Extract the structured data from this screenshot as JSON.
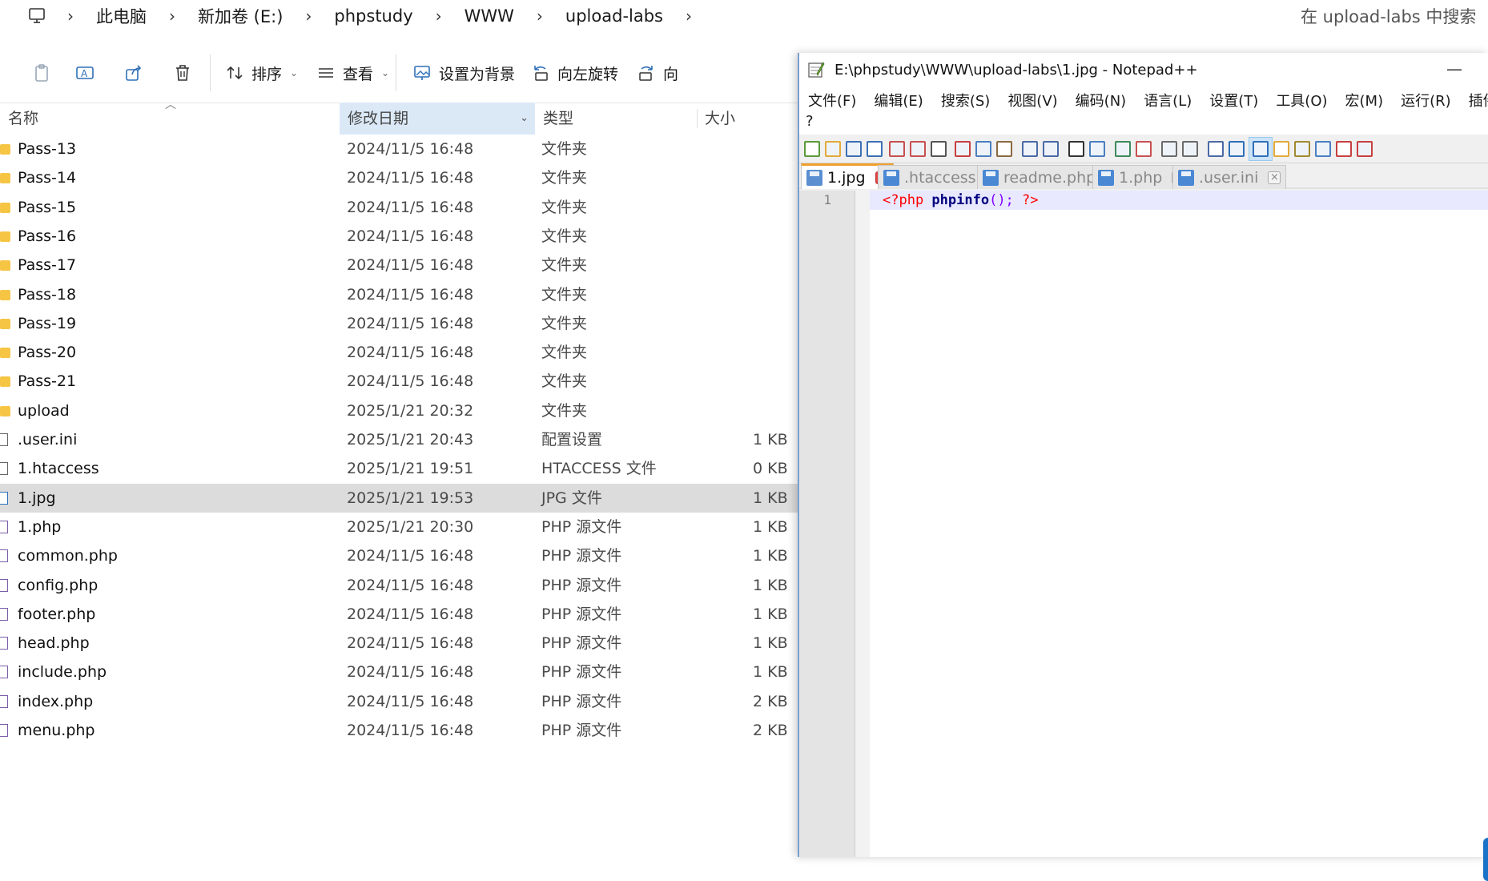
{
  "explorer": {
    "breadcrumb": [
      "此电脑",
      "新加卷 (E:)",
      "phpstudy",
      "WWW",
      "upload-labs"
    ],
    "search_placeholder": "在 upload-labs 中搜索",
    "toolbar": {
      "sort_label": "排序",
      "view_label": "查看",
      "set_bg_label": "设置为背景",
      "rotate_left_label": "向左旋转",
      "rotate_right_label": "向"
    },
    "columns": {
      "name": "名称",
      "date": "修改日期",
      "type": "类型",
      "size": "大小"
    },
    "files": [
      {
        "name": "Pass-13",
        "date": "2024/11/5 16:48",
        "type": "文件夹",
        "size": "",
        "kind": "folder"
      },
      {
        "name": "Pass-14",
        "date": "2024/11/5 16:48",
        "type": "文件夹",
        "size": "",
        "kind": "folder"
      },
      {
        "name": "Pass-15",
        "date": "2024/11/5 16:48",
        "type": "文件夹",
        "size": "",
        "kind": "folder"
      },
      {
        "name": "Pass-16",
        "date": "2024/11/5 16:48",
        "type": "文件夹",
        "size": "",
        "kind": "folder"
      },
      {
        "name": "Pass-17",
        "date": "2024/11/5 16:48",
        "type": "文件夹",
        "size": "",
        "kind": "folder"
      },
      {
        "name": "Pass-18",
        "date": "2024/11/5 16:48",
        "type": "文件夹",
        "size": "",
        "kind": "folder"
      },
      {
        "name": "Pass-19",
        "date": "2024/11/5 16:48",
        "type": "文件夹",
        "size": "",
        "kind": "folder"
      },
      {
        "name": "Pass-20",
        "date": "2024/11/5 16:48",
        "type": "文件夹",
        "size": "",
        "kind": "folder"
      },
      {
        "name": "Pass-21",
        "date": "2024/11/5 16:48",
        "type": "文件夹",
        "size": "",
        "kind": "folder"
      },
      {
        "name": "upload",
        "date": "2025/1/21 20:32",
        "type": "文件夹",
        "size": "",
        "kind": "folder"
      },
      {
        "name": ".user.ini",
        "date": "2025/1/21 20:43",
        "type": "配置设置",
        "size": "1 KB",
        "kind": "file"
      },
      {
        "name": "1.htaccess",
        "date": "2025/1/21 19:51",
        "type": "HTACCESS 文件",
        "size": "0 KB",
        "kind": "file"
      },
      {
        "name": "1.jpg",
        "date": "2025/1/21 19:53",
        "type": "JPG 文件",
        "size": "1 KB",
        "kind": "image",
        "selected": true
      },
      {
        "name": "1.php",
        "date": "2025/1/21 20:30",
        "type": "PHP 源文件",
        "size": "1 KB",
        "kind": "php"
      },
      {
        "name": "common.php",
        "date": "2024/11/5 16:48",
        "type": "PHP 源文件",
        "size": "1 KB",
        "kind": "php"
      },
      {
        "name": "config.php",
        "date": "2024/11/5 16:48",
        "type": "PHP 源文件",
        "size": "1 KB",
        "kind": "php"
      },
      {
        "name": "footer.php",
        "date": "2024/11/5 16:48",
        "type": "PHP 源文件",
        "size": "1 KB",
        "kind": "php"
      },
      {
        "name": "head.php",
        "date": "2024/11/5 16:48",
        "type": "PHP 源文件",
        "size": "1 KB",
        "kind": "php"
      },
      {
        "name": "include.php",
        "date": "2024/11/5 16:48",
        "type": "PHP 源文件",
        "size": "1 KB",
        "kind": "php"
      },
      {
        "name": "index.php",
        "date": "2024/11/5 16:48",
        "type": "PHP 源文件",
        "size": "2 KB",
        "kind": "php"
      },
      {
        "name": "menu.php",
        "date": "2024/11/5 16:48",
        "type": "PHP 源文件",
        "size": "2 KB",
        "kind": "php"
      }
    ]
  },
  "notepad": {
    "title": "E:\\phpstudy\\WWW\\upload-labs\\1.jpg - Notepad++",
    "minimize_glyph": "—",
    "menu": [
      "文件(F)",
      "编辑(E)",
      "搜索(S)",
      "视图(V)",
      "编码(N)",
      "语言(L)",
      "设置(T)",
      "工具(O)",
      "宏(M)",
      "运行(R)",
      "插件(P"
    ],
    "menu_help": "?",
    "tabs": [
      {
        "label": "1.jpg",
        "active": true
      },
      {
        "label": ".htaccess",
        "active": false
      },
      {
        "label": "readme.php",
        "active": false
      },
      {
        "label": "1.php",
        "active": false
      },
      {
        "label": ".user.ini",
        "active": false
      }
    ],
    "editor": {
      "line_number": "1",
      "code_open": "<?php ",
      "code_fn": "phpinfo",
      "code_punc": "();",
      "code_close": " ?>"
    }
  },
  "colors": {
    "selected_row": "#dcdcdc",
    "folder": "#f6c544",
    "npp_tab_accent": "#f0a030",
    "npp_current_line": "#e8e8ff",
    "php_tag": "#ff0000",
    "php_fn": "#000080",
    "php_punc": "#8000ff"
  }
}
